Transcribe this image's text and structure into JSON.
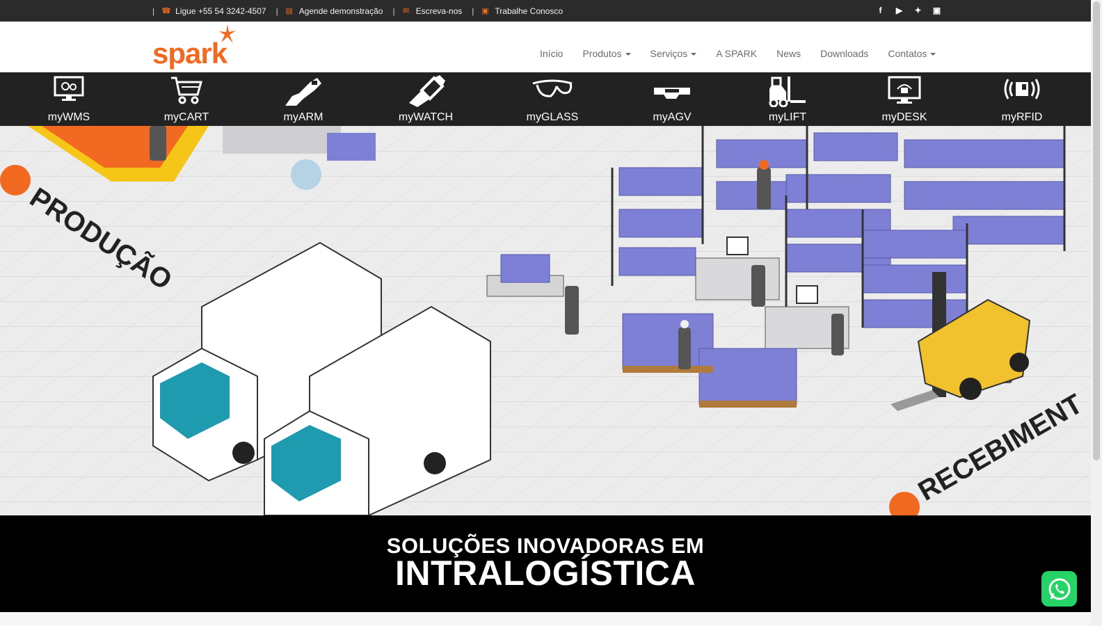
{
  "topbar": {
    "phone": "Ligue +55 54 3242-4507",
    "demo": "Agende demonstração",
    "email": "Escreva-nos",
    "careers": "Trabalhe Conosco",
    "social": [
      "facebook-icon",
      "youtube-icon",
      "twitter-icon",
      "instagram-icon"
    ]
  },
  "brand": {
    "name": "spark",
    "color": "#f26a21"
  },
  "nav": {
    "items": [
      {
        "label": "Início"
      },
      {
        "label": "Produtos"
      },
      {
        "label": "Serviços"
      },
      {
        "label": "A SPARK"
      },
      {
        "label": "News"
      },
      {
        "label": "Downloads"
      },
      {
        "label": "Contatos"
      }
    ]
  },
  "products": [
    {
      "label": "myWMS",
      "icon": "monitor-gears-icon"
    },
    {
      "label": "myCART",
      "icon": "cart-icon"
    },
    {
      "label": "myARM",
      "icon": "robot-arm-icon"
    },
    {
      "label": "myWATCH",
      "icon": "smartwatch-icon"
    },
    {
      "label": "myGLASS",
      "icon": "smart-glasses-icon"
    },
    {
      "label": "myAGV",
      "icon": "agv-icon"
    },
    {
      "label": "myLIFT",
      "icon": "forklift-icon"
    },
    {
      "label": "myDESK",
      "icon": "desk-monitor-icon"
    },
    {
      "label": "myRFID",
      "icon": "rfid-icon"
    }
  ],
  "hero": {
    "label_left": "PRODUÇÃO",
    "label_right": "RECEBIMENT"
  },
  "banner": {
    "line1": "SOLUÇÕES INOVADORAS EM",
    "line2": "INTRALOGÍSTICA"
  }
}
